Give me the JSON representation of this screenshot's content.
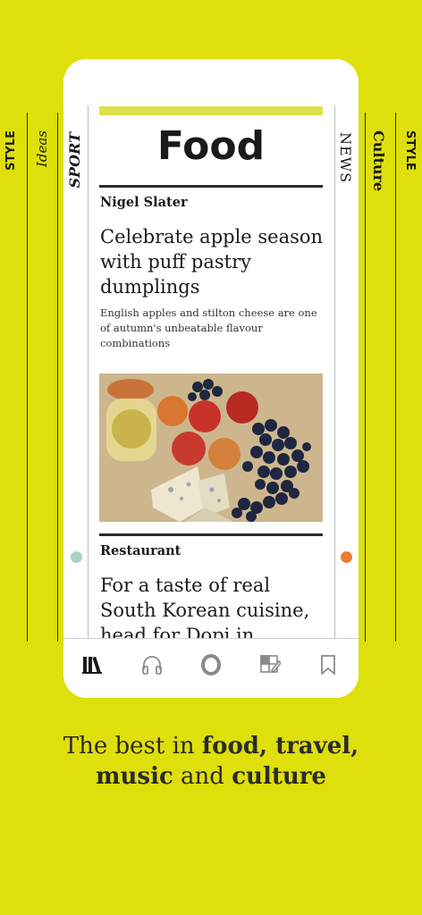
{
  "background_color": "#dfdf0b",
  "side_labels": {
    "left_outer": "STYLE",
    "left_mid": "Ideas",
    "left_inner": "SPORT",
    "right_inner": "NEWS",
    "right_mid": "Culture",
    "right_outer": "STYLE"
  },
  "section": {
    "title": "Food"
  },
  "article1": {
    "kicker": "Nigel Slater",
    "headline": "Celebrate apple season with puff pastry dumplings",
    "standfirst": "English apples and stilton cheese are one of autumn's unbeatable flavour combinations"
  },
  "article2": {
    "kicker": "Restaurant",
    "headline": "For a taste of real South Korean cuisine, head for Dopi in"
  },
  "dots": {
    "left_color": "#a3d4c6",
    "right_color": "#ef7d33"
  },
  "tabbar": {
    "icons": [
      "library-icon",
      "headphones-icon",
      "opinion-o-icon",
      "puzzles-icon",
      "bookmark-icon"
    ],
    "active": "library-icon"
  },
  "tagline": {
    "part1": "The best in ",
    "bold1": "food, travel,",
    "bold2": "music",
    "part2": " and ",
    "bold3": "culture"
  }
}
